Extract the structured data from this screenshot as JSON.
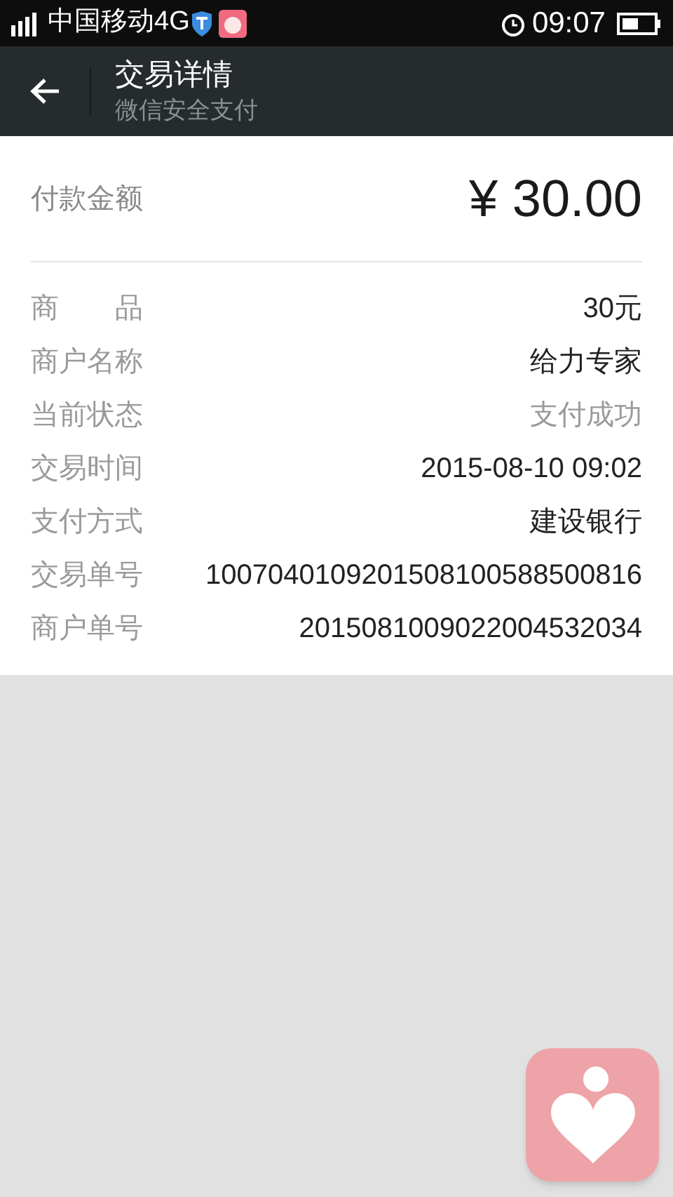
{
  "status_bar": {
    "carrier": "中国移动4G",
    "time": "09:07"
  },
  "header": {
    "title": "交易详情",
    "subtitle": "微信安全支付"
  },
  "amount": {
    "label": "付款金额",
    "value": "¥ 30.00"
  },
  "details": [
    {
      "label": "商　　品",
      "value": "30元",
      "muted": false
    },
    {
      "label": "商户名称",
      "value": "给力专家",
      "muted": false
    },
    {
      "label": "当前状态",
      "value": "支付成功",
      "muted": true
    },
    {
      "label": "交易时间",
      "value": "2015-08-10 09:02",
      "muted": false
    },
    {
      "label": "支付方式",
      "value": "建设银行",
      "muted": false
    },
    {
      "label": "交易单号",
      "value": "1007040109201508100588500816",
      "muted": false
    },
    {
      "label": "商户单号",
      "value": "2015081009022004532034",
      "muted": false
    }
  ]
}
